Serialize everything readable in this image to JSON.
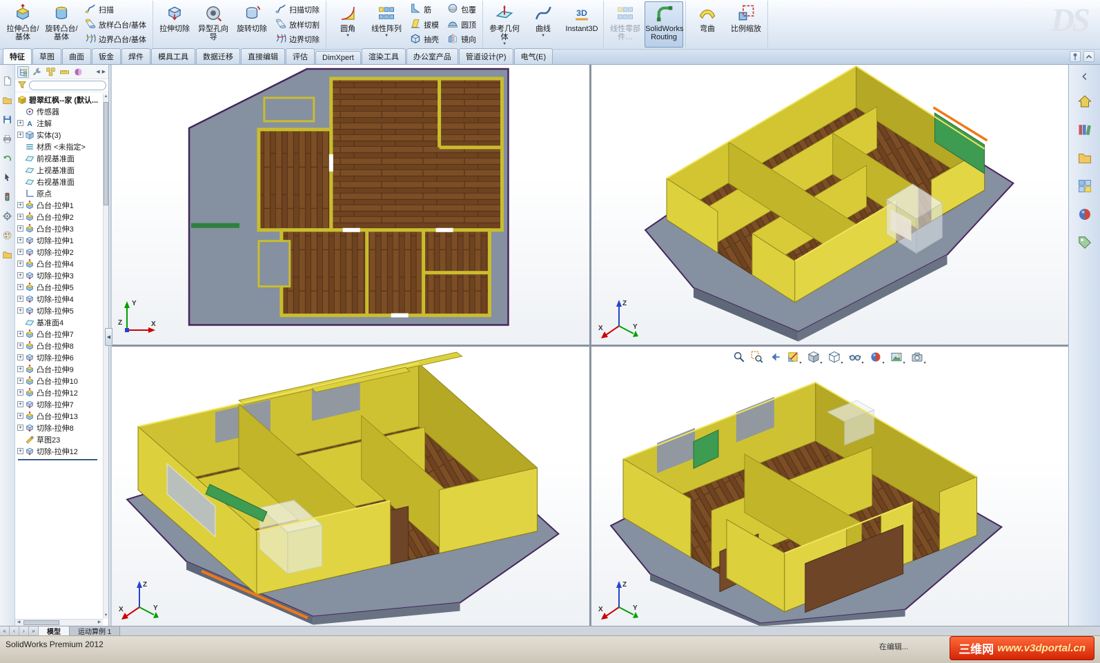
{
  "app": {
    "logo_text": "DS",
    "status_left": "SolidWorks Premium 2012",
    "status_editing": "在编辑...",
    "watermark_box": "三维网",
    "watermark_url": "www.v3dportal.cn"
  },
  "ribbon": {
    "groups": [
      {
        "items": [
          {
            "type": "large",
            "label": "拉伸凸台/基体",
            "icon": "extruded-boss"
          },
          {
            "type": "large",
            "label": "旋转凸台/基体",
            "icon": "revolved-boss"
          },
          {
            "type": "stack",
            "items": [
              {
                "label": "扫描",
                "icon": "swept-boss"
              },
              {
                "label": "放样凸台/基体",
                "icon": "lofted-boss"
              },
              {
                "label": "边界凸台/基体",
                "icon": "boundary-boss"
              }
            ]
          }
        ]
      },
      {
        "items": [
          {
            "type": "large",
            "label": "拉伸切除",
            "icon": "extruded-cut"
          },
          {
            "type": "large",
            "label": "异型孔向导",
            "icon": "hole-wizard"
          },
          {
            "type": "large",
            "label": "旋转切除",
            "icon": "revolved-cut"
          },
          {
            "type": "stack",
            "items": [
              {
                "label": "扫描切除",
                "icon": "swept-cut"
              },
              {
                "label": "放样切割",
                "icon": "lofted-cut"
              },
              {
                "label": "边界切除",
                "icon": "boundary-cut"
              }
            ]
          }
        ]
      },
      {
        "items": [
          {
            "type": "large",
            "label": "圆角",
            "icon": "fillet",
            "dropdown": true
          },
          {
            "type": "large",
            "label": "线性阵列",
            "icon": "linear-pattern",
            "dropdown": true
          },
          {
            "type": "stack",
            "items": [
              {
                "label": "筋",
                "icon": "rib"
              },
              {
                "label": "拔模",
                "icon": "draft"
              },
              {
                "label": "抽壳",
                "icon": "shell"
              }
            ]
          },
          {
            "type": "stack",
            "items": [
              {
                "label": "包覆",
                "icon": "wrap"
              },
              {
                "label": "圆顶",
                "icon": "dome"
              },
              {
                "label": "镜向",
                "icon": "mirror"
              }
            ]
          }
        ]
      },
      {
        "items": [
          {
            "type": "large",
            "label": "参考几何体",
            "icon": "reference-geometry",
            "dropdown": true
          },
          {
            "type": "large",
            "label": "曲线",
            "icon": "curves",
            "dropdown": true
          },
          {
            "type": "large",
            "label": "Instant3D",
            "icon": "instant3d"
          }
        ]
      },
      {
        "items": [
          {
            "type": "large",
            "label": "线性零部件…",
            "icon": "linear-component-pattern",
            "disabled": true
          },
          {
            "type": "large",
            "label": "SolidWorks Routing",
            "icon": "solidworks-routing",
            "active": true
          }
        ]
      },
      {
        "items": [
          {
            "type": "large",
            "label": "弯曲",
            "icon": "flex"
          },
          {
            "type": "large",
            "label": "比例缩放",
            "icon": "scale"
          }
        ]
      }
    ]
  },
  "tabs": {
    "items": [
      {
        "label": "特征",
        "active": true
      },
      {
        "label": "草图"
      },
      {
        "label": "曲面"
      },
      {
        "label": "钣金"
      },
      {
        "label": "焊件"
      },
      {
        "label": "模具工具"
      },
      {
        "label": "数据迁移"
      },
      {
        "label": "直接编辑"
      },
      {
        "label": "评估"
      },
      {
        "label": "DimXpert"
      },
      {
        "label": "渲染工具"
      },
      {
        "label": "办公室产品"
      },
      {
        "label": "管道设计(P)"
      },
      {
        "label": "电气(E)"
      }
    ],
    "right_icons": [
      "pin-icon",
      "collapse-ribbon-icon"
    ]
  },
  "left_strip": {
    "icons": [
      "new-document",
      "open",
      "save",
      "print",
      "undo",
      "select",
      "rebuild",
      "options",
      "color",
      "file-explorer"
    ]
  },
  "tree": {
    "manager_tabs": [
      "feature-manager",
      "property-manager",
      "configuration-manager",
      "dimxpert-manager",
      "display-manager"
    ],
    "nav_icons": [
      "scroll-left-icon",
      "scroll-right-icon"
    ],
    "filter_placeholder": "",
    "items": [
      {
        "icon": "part",
        "label": "碧翠红枫--家 (默认...",
        "level": 0,
        "plus": false
      },
      {
        "icon": "sensors",
        "label": "传感器",
        "level": 1,
        "plus": false
      },
      {
        "icon": "annotations",
        "label": "注解",
        "level": 1,
        "plus": true
      },
      {
        "icon": "solid-bodies",
        "label": "实体(3)",
        "level": 1,
        "plus": true
      },
      {
        "icon": "material",
        "label": "材质 <未指定>",
        "level": 1,
        "plus": false
      },
      {
        "icon": "plane",
        "label": "前视基准面",
        "level": 1,
        "plus": false
      },
      {
        "icon": "plane",
        "label": "上视基准面",
        "level": 1,
        "plus": false
      },
      {
        "icon": "plane",
        "label": "右视基准面",
        "level": 1,
        "plus": false
      },
      {
        "icon": "origin",
        "label": "原点",
        "level": 1,
        "plus": false
      },
      {
        "icon": "boss-extrude",
        "label": "凸台-拉伸1",
        "level": 1,
        "plus": true
      },
      {
        "icon": "boss-extrude",
        "label": "凸台-拉伸2",
        "level": 1,
        "plus": true
      },
      {
        "icon": "boss-extrude",
        "label": "凸台-拉伸3",
        "level": 1,
        "plus": true
      },
      {
        "icon": "cut-extrude",
        "label": "切除-拉伸1",
        "level": 1,
        "plus": true
      },
      {
        "icon": "cut-extrude",
        "label": "切除-拉伸2",
        "level": 1,
        "plus": true
      },
      {
        "icon": "boss-extrude",
        "label": "凸台-拉伸4",
        "level": 1,
        "plus": true
      },
      {
        "icon": "cut-extrude",
        "label": "切除-拉伸3",
        "level": 1,
        "plus": true
      },
      {
        "icon": "boss-extrude",
        "label": "凸台-拉伸5",
        "level": 1,
        "plus": true
      },
      {
        "icon": "cut-extrude",
        "label": "切除-拉伸4",
        "level": 1,
        "plus": true
      },
      {
        "icon": "cut-extrude",
        "label": "切除-拉伸5",
        "level": 1,
        "plus": true
      },
      {
        "icon": "plane",
        "label": "基准面4",
        "level": 1,
        "plus": false
      },
      {
        "icon": "boss-extrude",
        "label": "凸台-拉伸7",
        "level": 1,
        "plus": true
      },
      {
        "icon": "boss-extrude",
        "label": "凸台-拉伸8",
        "level": 1,
        "plus": true
      },
      {
        "icon": "cut-extrude",
        "label": "切除-拉伸6",
        "level": 1,
        "plus": true
      },
      {
        "icon": "boss-extrude",
        "label": "凸台-拉伸9",
        "level": 1,
        "plus": true
      },
      {
        "icon": "boss-extrude",
        "label": "凸台-拉伸10",
        "level": 1,
        "plus": true
      },
      {
        "icon": "boss-extrude",
        "label": "凸台-拉伸12",
        "level": 1,
        "plus": true
      },
      {
        "icon": "cut-extrude",
        "label": "切除-拉伸7",
        "level": 1,
        "plus": true
      },
      {
        "icon": "boss-extrude",
        "label": "凸台-拉伸13",
        "level": 1,
        "plus": true
      },
      {
        "icon": "cut-extrude",
        "label": "切除-拉伸8",
        "level": 1,
        "plus": true
      },
      {
        "icon": "sketch",
        "label": "草图23",
        "level": 1,
        "plus": false
      },
      {
        "icon": "cut-extrude",
        "label": "切除-拉伸12",
        "level": 1,
        "plus": true
      }
    ]
  },
  "viewport": {
    "hud": [
      {
        "icon": "zoom-to-fit"
      },
      {
        "icon": "zoom-to-area"
      },
      {
        "icon": "previous-view"
      },
      {
        "icon": "section-view",
        "dropdown": true
      },
      {
        "icon": "view-orientation",
        "dropdown": true
      },
      {
        "icon": "display-style",
        "dropdown": true
      },
      {
        "icon": "hide-show-items",
        "dropdown": true
      },
      {
        "icon": "edit-appearance",
        "dropdown": true
      },
      {
        "icon": "apply-scene",
        "dropdown": true
      },
      {
        "icon": "view-settings",
        "dropdown": true
      }
    ],
    "triad": {
      "x": "X",
      "y": "Y",
      "z": "Z"
    },
    "colors": {
      "wall": "#d2c531",
      "floor": "#6e431f",
      "slab": "#8590a0",
      "edge": "#46265c",
      "accent_green": "#3d9b52",
      "accent_orange": "#f07818"
    }
  },
  "bottom": {
    "nav_icons": [
      "first-tab-icon",
      "prev-tab-icon",
      "next-tab-icon",
      "last-tab-icon"
    ],
    "tabs": [
      {
        "label": "模型",
        "active": true
      },
      {
        "label": "运动算例 1"
      }
    ]
  },
  "taskpane": {
    "icons": [
      "chevron-left",
      "solidworks-resources",
      "design-library",
      "file-explorer",
      "view-palette",
      "appearances-scenes",
      "custom-properties"
    ]
  }
}
